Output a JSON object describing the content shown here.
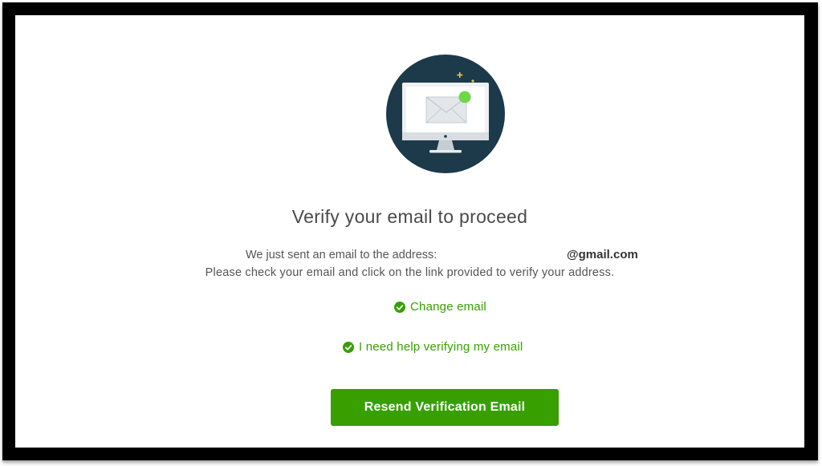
{
  "verify": {
    "title": "Verify your email to proceed",
    "sent_text": "We just sent an email to the address:",
    "email_domain": "@gmail.com",
    "instructions": "Please check your email and click on the link provided to verify your address.",
    "change_email_label": "Change email",
    "help_label": "I need help verifying my email",
    "resend_label": "Resend Verification Email"
  },
  "colors": {
    "accent": "#37a000",
    "illustration_bg": "#1d3a4a",
    "notification_dot": "#6fd64a",
    "sparkle": "#e8c547"
  },
  "icons": {
    "illustration": "monitor-envelope-illustration",
    "link_icon": "check-circle-icon"
  }
}
